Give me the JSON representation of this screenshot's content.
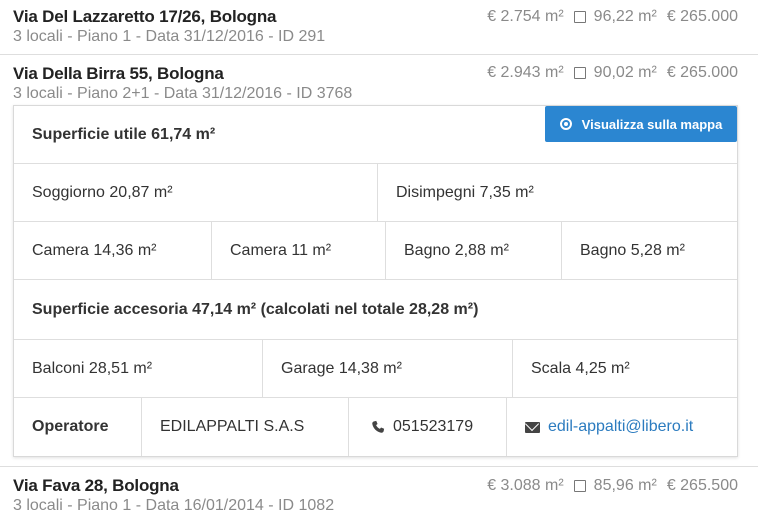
{
  "listings": [
    {
      "address": "Via Del Lazzaretto 17/26, Bologna",
      "meta": "3 locali - Piano 1 - Data 31/12/2016 - ID 291",
      "price_per_sqm": "€  2.754 m²",
      "area": "96,22 m²",
      "price": "€  265.000"
    },
    {
      "address": "Via Della Birra 55, Bologna",
      "meta": "3 locali - Piano 2+1 - Data 31/12/2016 - ID 3768",
      "price_per_sqm": "€  2.943 m²",
      "area": "90,02 m²",
      "price": "€  265.000"
    },
    {
      "address": "Via Fava 28, Bologna",
      "meta": "3 locali - Piano 1 - Data 16/01/2014 - ID 1082",
      "price_per_sqm": "€  3.088 m²",
      "area": "85,96 m²",
      "price": "€  265.500"
    }
  ],
  "detail": {
    "map_button": "Visualizza sulla mappa",
    "superficie_utile": "Superficie utile 61,74 m²",
    "rooms_row1": [
      "Soggiorno 20,87 m²",
      "Disimpegni 7,35 m²"
    ],
    "rooms_row2": [
      "Camera 14,36 m²",
      "Camera 11 m²",
      "Bagno 2,88 m²",
      "Bagno 5,28 m²"
    ],
    "superficie_accessoria": "Superficie accesoria 47,14 m² (calcolati nel totale 28,28 m²)",
    "accessory_row": [
      "Balconi 28,51 m²",
      "Garage 14,38 m²",
      "Scala 4,25 m²"
    ],
    "operator_label": "Operatore",
    "operator_name": "EDILAPPALTI S.A.S",
    "phone": "051523179",
    "email": "edil-appalti@libero.it"
  },
  "icons": {
    "map": "map-marker-icon",
    "phone": "phone-icon",
    "email": "envelope-icon",
    "area": "square-icon"
  },
  "colors": {
    "accent": "#2b86d1",
    "link": "#2b7bbf",
    "muted": "#8a8a8a"
  }
}
